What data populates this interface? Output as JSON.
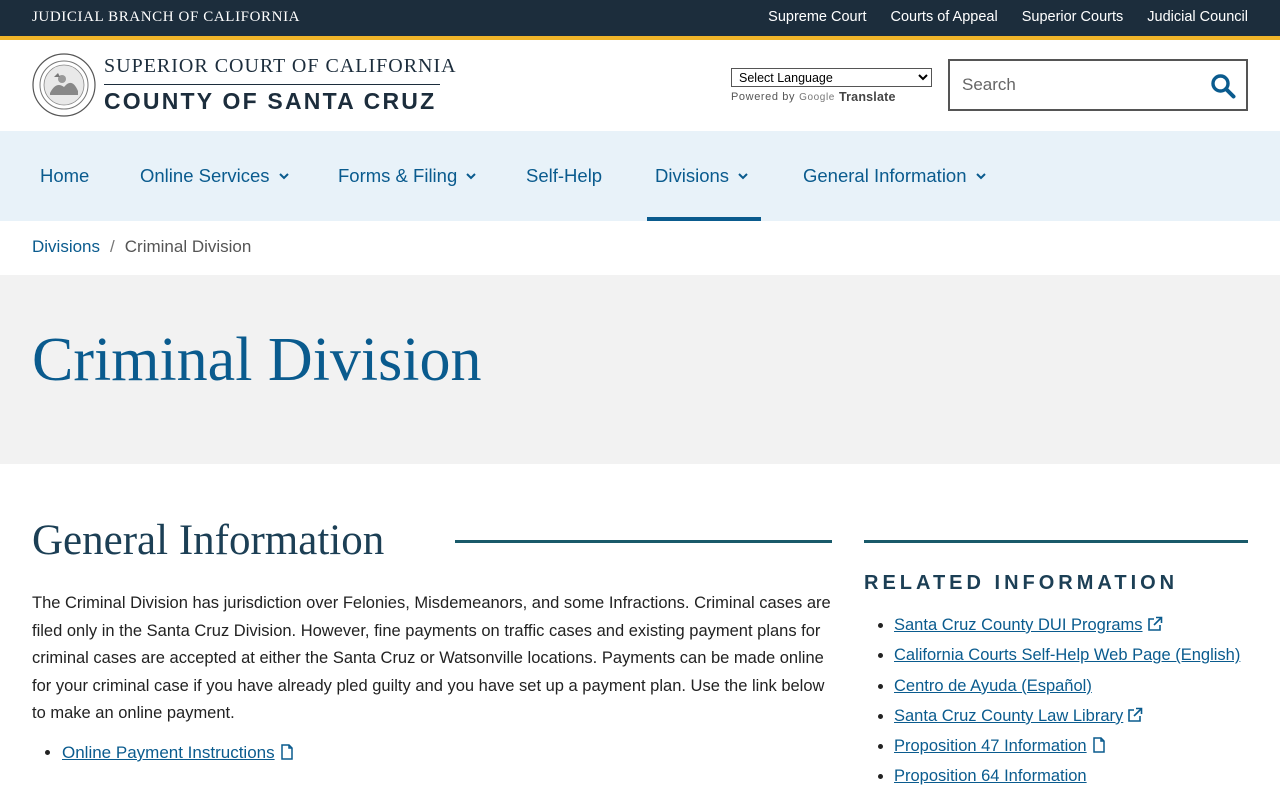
{
  "topbar": {
    "branch": "JUDICIAL BRANCH OF CALIFORNIA",
    "links": [
      "Supreme Court",
      "Courts of Appeal",
      "Superior Courts",
      "Judicial Council"
    ]
  },
  "header": {
    "court_line1": "SUPERIOR COURT OF CALIFORNIA",
    "court_line2": "COUNTY OF SANTA CRUZ",
    "language_select": "Select Language",
    "powered_by": "Powered by",
    "google": "Google",
    "translate": "Translate",
    "search_placeholder": "Search"
  },
  "nav": {
    "items": [
      {
        "label": "Home"
      },
      {
        "label": "Online Services"
      },
      {
        "label": "Forms & Filing"
      },
      {
        "label": "Self-Help"
      },
      {
        "label": "Divisions"
      },
      {
        "label": "General Information"
      }
    ],
    "active": "Divisions"
  },
  "breadcrumb": {
    "parent": "Divisions",
    "separator": "/",
    "current": "Criminal Division"
  },
  "page_title": "Criminal Division",
  "main": {
    "section_title": "General Information",
    "body": "The Criminal Division has jurisdiction over Felonies, Misdemeanors, and some Infractions. Criminal cases are filed only in the Santa Cruz Division. However, fine payments on traffic cases and existing payment plans for criminal cases are accepted at either the Santa Cruz or Watsonville locations. Payments can be made online for your criminal case if you have already pled guilty and you have set up a payment plan. Use the link below to make an online payment.",
    "links": [
      "Online Payment Instructions"
    ]
  },
  "sidebar": {
    "title": "RELATED INFORMATION",
    "links": [
      "Santa Cruz County DUI Programs",
      "California Courts Self-Help Web Page (English)",
      "Centro de Ayuda (Español)",
      "Santa Cruz County Law Library",
      "Proposition 47 Information",
      "Proposition 64 Information"
    ]
  },
  "colors": {
    "topbar": "#1c2d3c",
    "accent_stripe": "#f0b429",
    "link": "#0a5b8e",
    "nav_bg": "#e8f2f9",
    "hero_bg": "#f2f2f2"
  }
}
